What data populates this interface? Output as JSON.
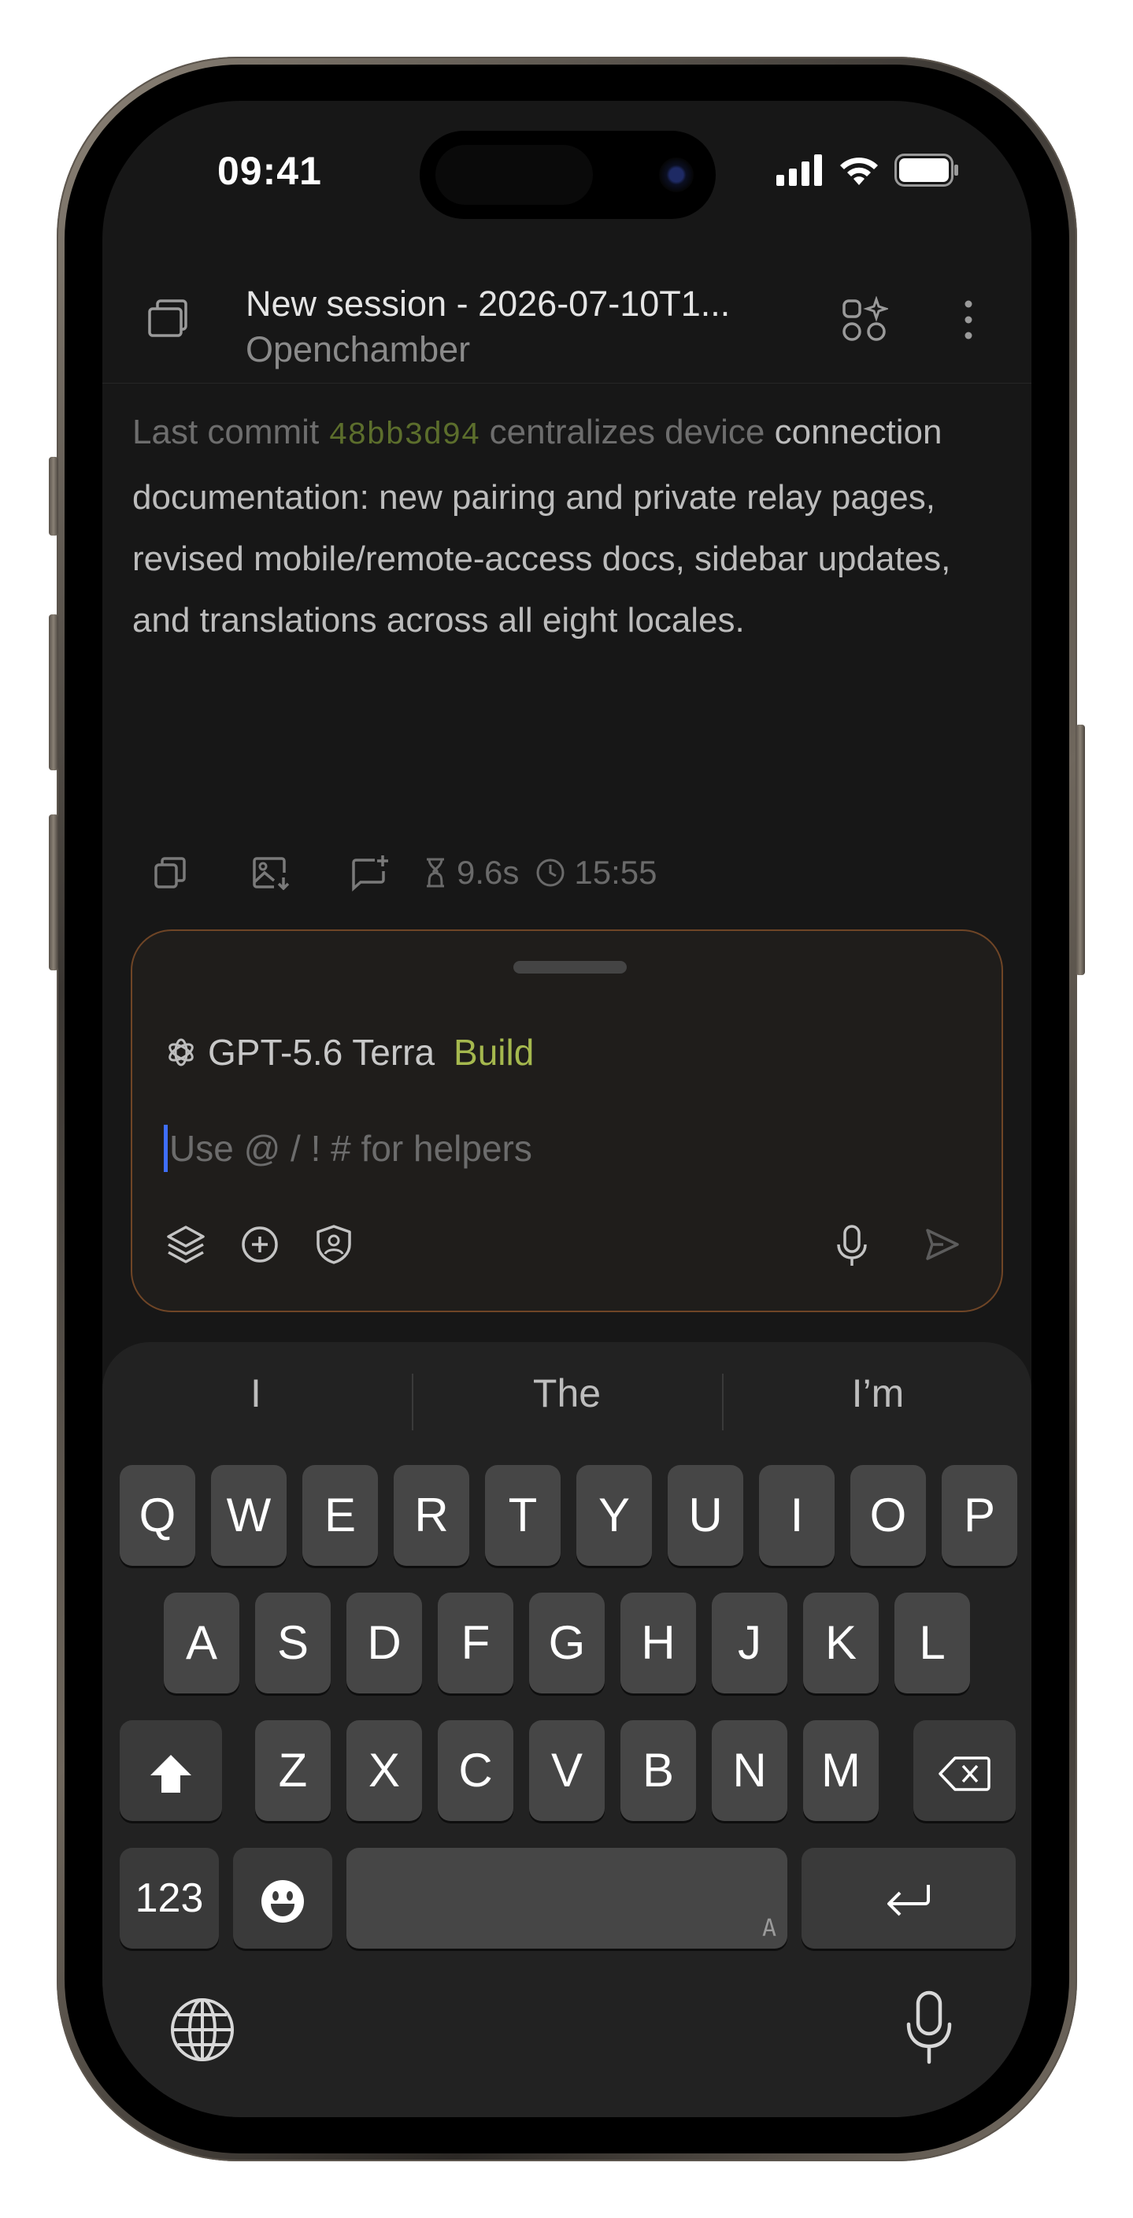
{
  "status_bar": {
    "time": "09:41"
  },
  "header": {
    "title": "New session - 2026-07-10T1...",
    "subtitle": "Openchamber"
  },
  "message": {
    "prefix": "Last commit ",
    "commit_hash": "48bb3d94",
    "text_dim": " centralizes device",
    "text": "connection documentation: new pairing and private relay pages, revised mobile/remote-access docs, sidebar updates, and translations across all eight locales.",
    "duration": "9.6s",
    "timestamp": "15:55"
  },
  "composer": {
    "model": "GPT-5.6 Terra",
    "mode": "Build",
    "placeholder": "Use @ / ! # for helpers",
    "accent_color": "#a5b84e",
    "border_color": "#6f4526"
  },
  "keyboard": {
    "suggestions": [
      "I",
      "The",
      "I’m"
    ],
    "row1": [
      "Q",
      "W",
      "E",
      "R",
      "T",
      "Y",
      "U",
      "I",
      "O",
      "P"
    ],
    "row2": [
      "A",
      "S",
      "D",
      "F",
      "G",
      "H",
      "J",
      "K",
      "L"
    ],
    "row3": [
      "Z",
      "X",
      "C",
      "V",
      "B",
      "N",
      "M"
    ],
    "numbers_key": "123",
    "space_hint": "A"
  },
  "icons": {
    "header_left": "sessions-icon",
    "header_apps": "apps-sparkle-icon",
    "header_menu": "more-vertical-icon",
    "copy": "copy-icon",
    "image": "image-download-icon",
    "fork": "message-plus-icon",
    "hourglass": "hourglass-icon",
    "clock": "clock-icon",
    "model": "openai-icon",
    "layers": "layers-icon",
    "add": "plus-circle-icon",
    "shield": "shield-user-icon",
    "mic": "mic-icon",
    "send": "send-icon",
    "shift": "shift-icon",
    "backspace": "backspace-icon",
    "emoji": "emoji-icon",
    "return": "return-icon",
    "globe": "globe-icon",
    "dictation": "dictation-mic-icon"
  }
}
